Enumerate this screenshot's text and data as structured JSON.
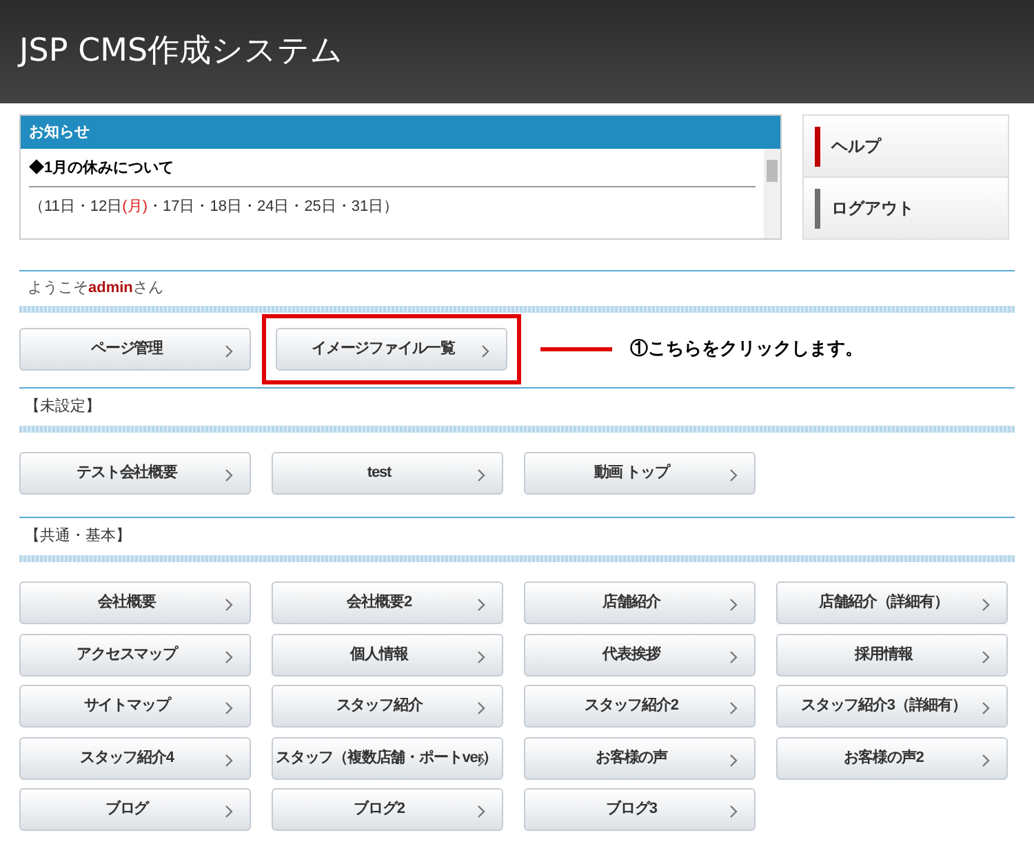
{
  "header": {
    "title": "JSP CMS作成システム"
  },
  "notice": {
    "title": "お知らせ",
    "headline": "◆1月の休みについて",
    "body": [
      {
        "text": "（11日・12日",
        "highlight": false
      },
      {
        "text": "(月)",
        "highlight": true
      },
      {
        "text": "・17日・18日・24日・25日・31日）",
        "highlight": false
      }
    ]
  },
  "side_menu": [
    {
      "label": "ヘルプ",
      "color": "#c00000"
    },
    {
      "label": "ログアウト",
      "color": "#707070"
    }
  ],
  "welcome": [
    {
      "text": "ようこそ",
      "highlight": false
    },
    {
      "text": "admin",
      "highlight": true
    },
    {
      "text": "さん",
      "highlight": false
    }
  ],
  "top_buttons": [
    {
      "label": "ページ管理",
      "highlighted": false
    },
    {
      "label": "イメージファイル一覧",
      "highlighted": true
    }
  ],
  "callout": "①こちらをクリックします。",
  "sections": [
    {
      "title": "【未設定】",
      "buttons": [
        "テスト会社概要",
        "test",
        "動画 トップ"
      ]
    },
    {
      "title": "【共通・基本】",
      "buttons": [
        "会社概要",
        "会社概要2",
        "店舗紹介",
        "店舗紹介（詳細有）",
        "アクセスマップ",
        "個人情報",
        "代表挨拶",
        "採用情報",
        "サイトマップ",
        "スタッフ紹介",
        "スタッフ紹介2",
        "スタッフ紹介3（詳細有）",
        "スタッフ紹介4",
        "スタッフ（複数店舗・ポートver）",
        "お客様の声",
        "お客様の声2",
        "ブログ",
        "ブログ2",
        "ブログ3"
      ]
    }
  ]
}
